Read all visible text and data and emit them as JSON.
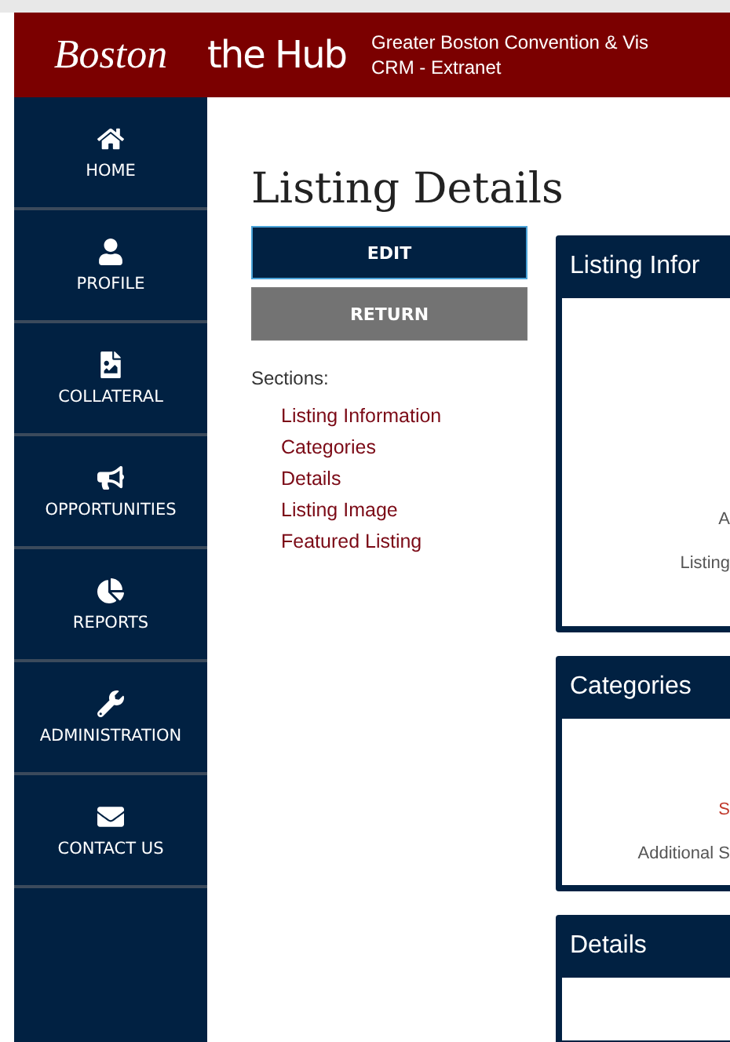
{
  "header": {
    "logo_left": "Boston",
    "logo_right": "the Hub",
    "title_line_1": "Greater Boston Convention & Vis",
    "title_line_2": "CRM - Extranet"
  },
  "nav": [
    {
      "label": "HOME"
    },
    {
      "label": "PROFILE"
    },
    {
      "label": "COLLATERAL"
    },
    {
      "label": "OPPORTUNITIES"
    },
    {
      "label": "REPORTS"
    },
    {
      "label": "ADMINISTRATION"
    },
    {
      "label": "CONTACT US"
    }
  ],
  "page_title": "Listing Details",
  "buttons": [
    {
      "label": "EDIT",
      "kind": "primary"
    },
    {
      "label": "RETURN",
      "kind": "secondary"
    }
  ],
  "sections_label": "Sections:",
  "section_links": [
    "Listing Information",
    "Categories",
    "Details",
    "Listing Image",
    "Featured Listing"
  ],
  "cards": [
    {
      "title": "Listing Infor",
      "fields": [
        {
          "label": "A",
          "kind": "plain"
        },
        {
          "label": "Listing",
          "kind": "plain"
        }
      ]
    },
    {
      "title": "Categories",
      "fields": [
        {
          "label": "S",
          "kind": "required"
        },
        {
          "label": "Additional S",
          "kind": "plain"
        }
      ]
    },
    {
      "title": "Details"
    }
  ]
}
